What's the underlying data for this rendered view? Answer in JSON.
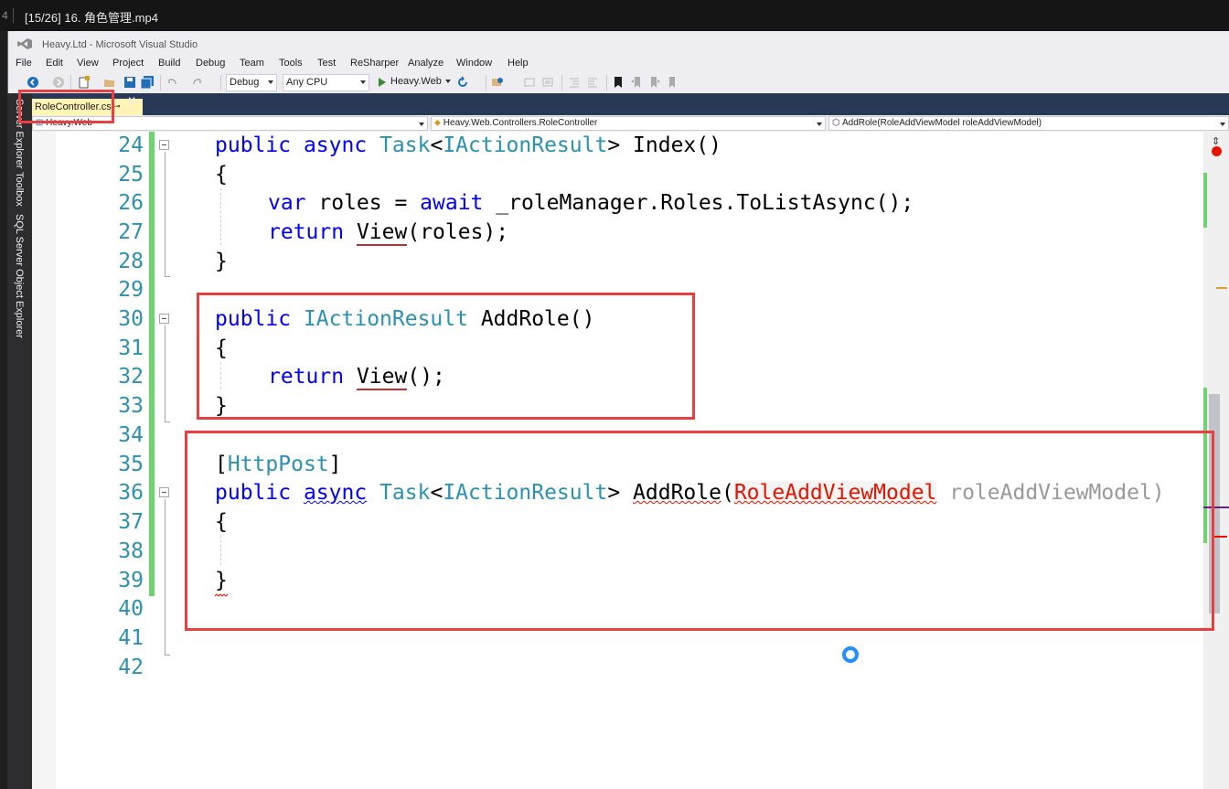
{
  "player": {
    "index": "4",
    "title": "[15/26] 16. 角色管理.mp4"
  },
  "window": {
    "title": "Heavy.Ltd - Microsoft Visual Studio"
  },
  "menu": [
    "File",
    "Edit",
    "View",
    "Project",
    "Build",
    "Debug",
    "Team",
    "Tools",
    "Test",
    "ReSharper",
    "Analyze",
    "Window",
    "Help"
  ],
  "toolbar": {
    "config": "Debug",
    "platform": "Any CPU",
    "start_label": "Heavy.Web"
  },
  "sidebar": {
    "tabs": [
      "Server Explorer",
      "Toolbox",
      "SQL Server Object Explorer"
    ]
  },
  "document": {
    "tab_label": "RoleController.cs",
    "nav_project": "Heavy.Web",
    "nav_class": "Heavy.Web.Controllers.RoleController",
    "nav_member": "AddRole(RoleAddViewModel roleAddViewModel)"
  },
  "code": {
    "line_numbers": [
      "24",
      "25",
      "26",
      "27",
      "28",
      "29",
      "30",
      "31",
      "32",
      "33",
      "34",
      "35",
      "36",
      "37",
      "38",
      "39",
      "40",
      "41",
      "42"
    ],
    "l24": {
      "kw1": "public",
      "kw2": "async",
      "type": "Task",
      "lt": "<",
      "iface": "IActionResult",
      "rest": "> Index()"
    },
    "l25": "{",
    "l26": {
      "kw1": "var",
      "mid": " roles = ",
      "kw2": "await",
      "rest": " _roleManager.Roles.ToListAsync();"
    },
    "l27": {
      "kw": "return",
      "call": "View",
      "rest": "(roles);"
    },
    "l28": "}",
    "l30": {
      "kw": "public",
      "iface": "IActionResult",
      "rest": " AddRole()"
    },
    "l31": "{",
    "l32": {
      "kw": "return",
      "call": "View",
      "rest": "();"
    },
    "l33": "}",
    "l35": {
      "open": "[",
      "attr": "HttpPost",
      "close": "]"
    },
    "l36": {
      "kw1": "public",
      "kw2": "async",
      "type": "Task",
      "lt": "<",
      "iface": "IActionResult",
      "gt": "> ",
      "method": "AddRole",
      "paren": "(",
      "ptype": "RoleAddViewModel",
      "pname": " roleAddViewModel)"
    },
    "l37": "{",
    "l39": "}"
  }
}
